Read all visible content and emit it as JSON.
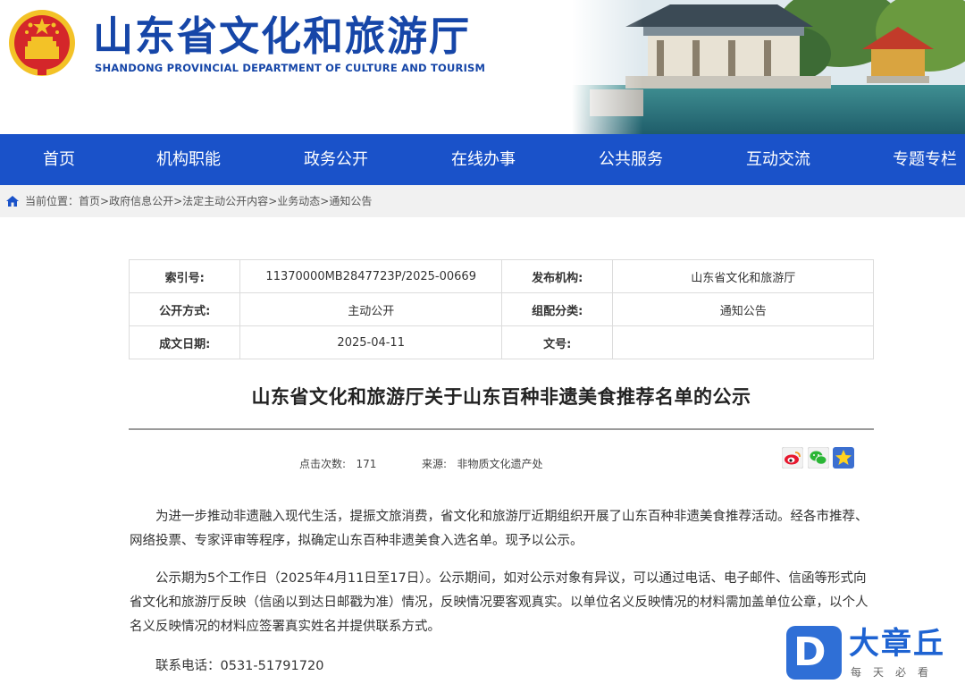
{
  "header": {
    "title_cn": "山东省文化和旅游厅",
    "title_en": "SHANDONG PROVINCIAL DEPARTMENT OF CULTURE AND TOURISM"
  },
  "nav": {
    "items": [
      "首页",
      "机构职能",
      "政务公开",
      "在线办事",
      "公共服务",
      "互动交流",
      "专题专栏"
    ]
  },
  "breadcrumb": {
    "prefix": "当前位置：",
    "items": [
      "首页",
      "政府信息公开",
      "法定主动公开内容",
      "业务动态",
      "通知公告"
    ],
    "separator": ">"
  },
  "info": {
    "index_label": "索引号:",
    "index_value": "11370000MB2847723P/2025-00669",
    "publisher_label": "发布机构:",
    "publisher_value": "山东省文化和旅游厅",
    "method_label": "公开方式:",
    "method_value": "主动公开",
    "category_label": "组配分类:",
    "category_value": "通知公告",
    "date_label": "成文日期:",
    "date_value": "2025-04-11",
    "docno_label": "文号:",
    "docno_value": ""
  },
  "article": {
    "title": "山东省文化和旅游厅关于山东百种非遗美食推荐名单的公示",
    "views_label": "点击次数:",
    "views_value": "171",
    "source_label": "来源:",
    "source_value": "非物质文化遗产处",
    "paragraphs": [
      "为进一步推动非遗融入现代生活，提振文旅消费，省文化和旅游厅近期组织开展了山东百种非遗美食推荐活动。经各市推荐、网络投票、专家评审等程序，拟确定山东百种非遗美食入选名单。现予以公示。",
      "公示期为5个工作日（2025年4月11日至17日）。公示期间，如对公示对象有异议，可以通过电话、电子邮件、信函等形式向省文化和旅游厅反映（信函以到达日邮戳为准）情况，反映情况要客观真实。以单位名义反映情况的材料需加盖单位公章，以个人名义反映情况的材料应签署真实姓名并提供联系方式。"
    ],
    "phone": "联系电话：0531-51791720"
  },
  "share_icons": [
    "weibo-icon",
    "wechat-icon",
    "favorite-star-icon"
  ],
  "watermark": {
    "letter": "D",
    "name": "大章丘",
    "slogan": "每天必看"
  },
  "colors": {
    "nav_bg": "#1a52c9",
    "title_blue": "#1646a8",
    "crumb_bg": "#f1f1f1",
    "emblem_red": "#d4262a",
    "emblem_gold": "#f3c227"
  }
}
